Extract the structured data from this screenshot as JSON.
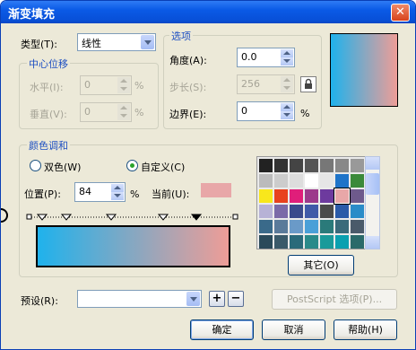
{
  "window": {
    "title": "渐变填充"
  },
  "type_label": "类型(T):",
  "type_value": "线性",
  "center_offset": {
    "title": "中心位移",
    "horizontal_label": "水平(I):",
    "horizontal_value": "0",
    "vertical_label": "垂直(V):",
    "vertical_value": "0",
    "unit": "%"
  },
  "options": {
    "title": "选项",
    "angle_label": "角度(A):",
    "angle_value": "0.0",
    "steps_label": "步长(S):",
    "steps_value": "256",
    "edge_label": "边界(E):",
    "edge_value": "0",
    "unit": "%"
  },
  "blend": {
    "title": "颜色调和",
    "two_color_label": "双色(W)",
    "custom_label": "自定义(C)",
    "position_label": "位置(P):",
    "position_value": "84",
    "unit": "%",
    "current_label": "当前(U):",
    "current_color": "#e8a7a8",
    "gradient_start": "#1fb2ec",
    "gradient_end": "#ee9d97"
  },
  "palette": {
    "colors": [
      "#222222",
      "#333333",
      "#444444",
      "#555555",
      "#777777",
      "#888888",
      "#999999",
      "#bbbbbb",
      "#cccccc",
      "#dddddd",
      "#ffffff",
      "#e6e6e6",
      "#1f74c9",
      "#3b8a3a",
      "#f8e71c",
      "#e8411e",
      "#e01e7a",
      "#9c3a8b",
      "#6d3a9e",
      "#e8a7a8",
      "#6e5a8c",
      "#b7b2d6",
      "#7b6aa8",
      "#3a4a8c",
      "#3f5aa8",
      "#4a4a4a",
      "#2a5aa8",
      "#2a8cc8",
      "#3a6a8a",
      "#5a7a9a",
      "#6a9ac8",
      "#4aa0d8",
      "#2a7a7a",
      "#3a6a7a",
      "#4a5a6a",
      "#2a4a5a",
      "#3a5a6a",
      "#2a6a7a",
      "#2a8a8a",
      "#1a9a9a",
      "#0aa0b0",
      "#2a6a6a"
    ],
    "selected_index": 19,
    "other_label": "其它(O)"
  },
  "preset": {
    "label": "预设(R):",
    "value": "",
    "add_label": "+",
    "remove_label": "−"
  },
  "postscript_label": "PostScript 选项(P)...",
  "buttons": {
    "ok": "确定",
    "cancel": "取消",
    "help": "帮助(H)"
  }
}
